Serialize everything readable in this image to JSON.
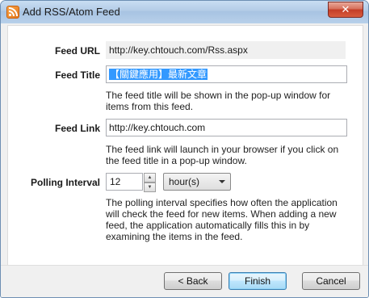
{
  "window": {
    "title": "Add RSS/Atom Feed",
    "close_label": "✕"
  },
  "form": {
    "feed_url": {
      "label": "Feed URL",
      "value": "http://key.chtouch.com/Rss.aspx"
    },
    "feed_title": {
      "label": "Feed Title",
      "value": "【關鍵應用】最新文章",
      "help": "The feed title will be shown in the pop-up window for items from this feed."
    },
    "feed_link": {
      "label": "Feed Link",
      "value": "http://key.chtouch.com",
      "help": "The feed link will launch in your browser if you click on the feed title in a pop-up window."
    },
    "polling": {
      "label": "Polling Interval",
      "value": "12",
      "unit": "hour(s)",
      "help": "The polling interval specifies how often the application will check the feed for new items. When adding a new feed, the application automatically fills this in by examining the items in the feed."
    }
  },
  "buttons": {
    "back": "< Back",
    "finish": "Finish",
    "cancel": "Cancel"
  },
  "icons": {
    "app": "rss-icon",
    "close": "close-icon",
    "spin_up": "arrow-up-icon",
    "spin_down": "arrow-down-icon",
    "dropdown": "chevron-down-icon"
  }
}
